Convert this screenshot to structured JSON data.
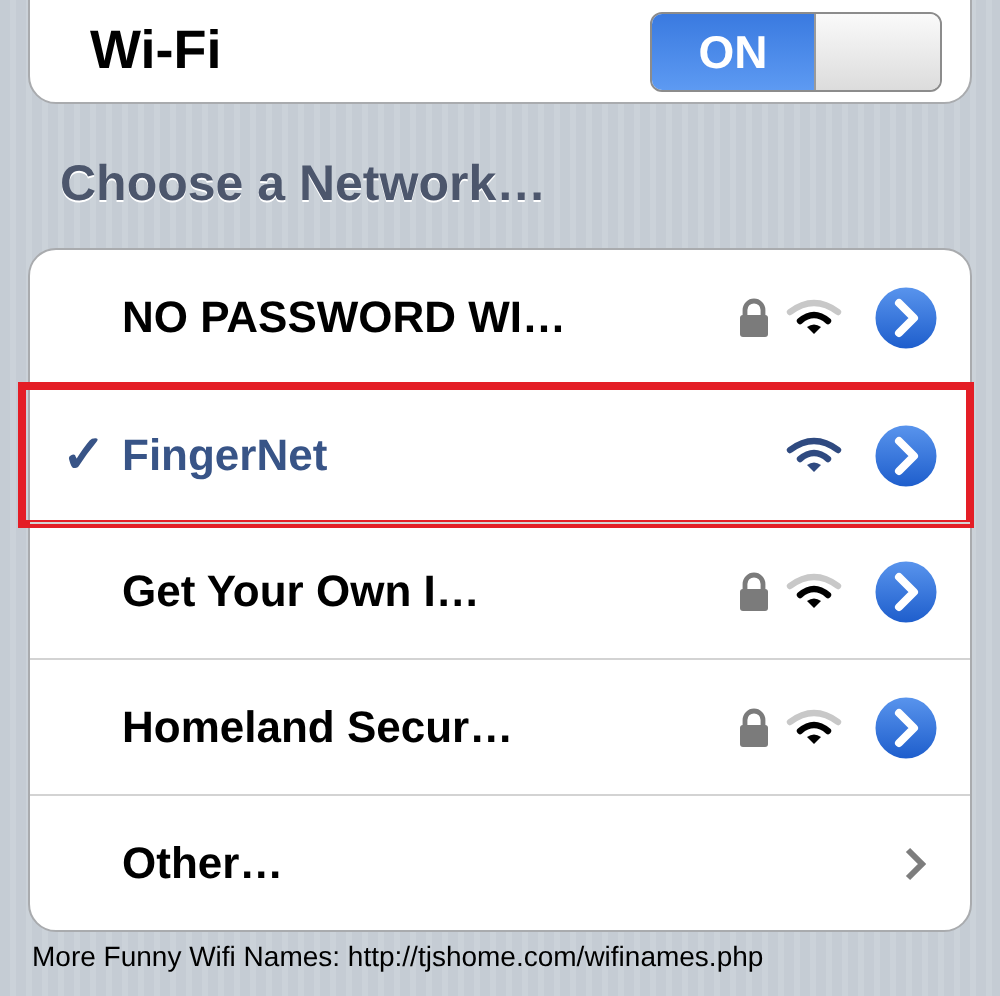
{
  "wifi": {
    "label": "Wi-Fi",
    "on": true,
    "switch_text": "ON"
  },
  "section_header": "Choose a Network…",
  "networks": [
    {
      "kind": "network",
      "name": "NO PASSWORD WI…",
      "selected": false,
      "locked": true
    },
    {
      "kind": "network",
      "name": "FingerNet",
      "selected": true,
      "locked": false,
      "check": "✓"
    },
    {
      "kind": "network",
      "name": "Get Your Own I…",
      "selected": false,
      "locked": true
    },
    {
      "kind": "network",
      "name": "Homeland Secur…",
      "selected": false,
      "locked": true
    },
    {
      "kind": "other",
      "name": "Other…"
    }
  ],
  "footer": "More Funny Wifi Names: http://tjshome.com/wifinames.php"
}
